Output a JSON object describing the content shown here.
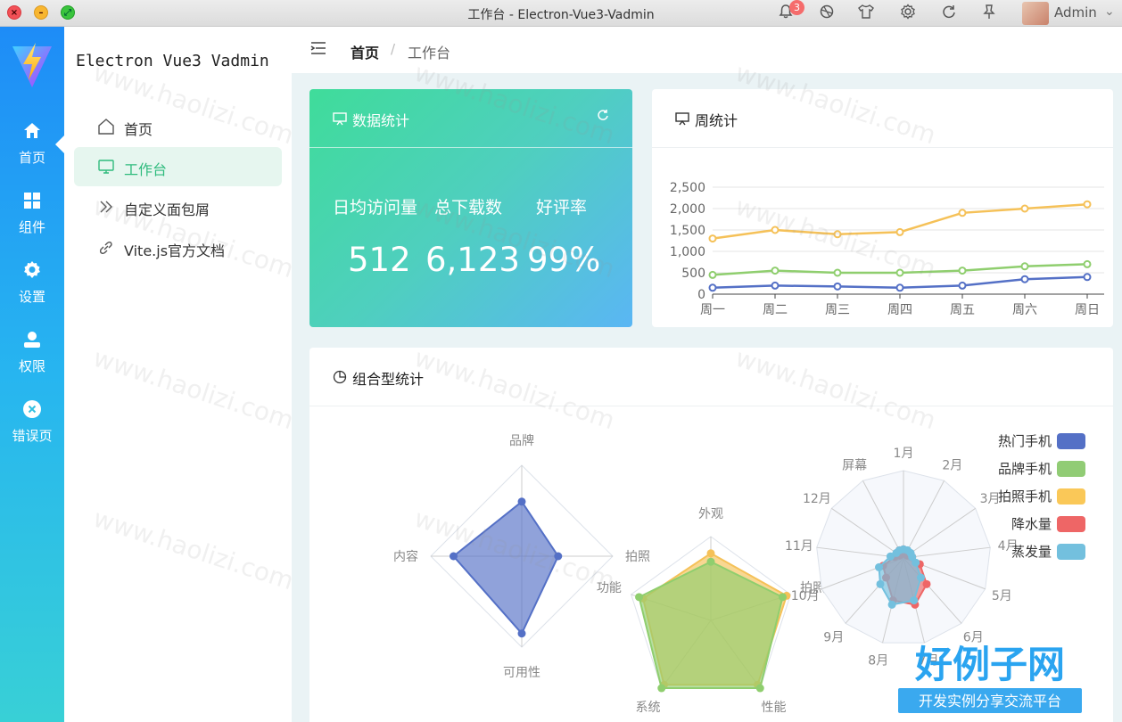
{
  "window": {
    "title": "工作台 - Electron-Vue3-Vadmin",
    "notification_count": "3",
    "user_name": "Admin"
  },
  "rail": {
    "items": [
      {
        "label": "首页",
        "icon": "home-icon"
      },
      {
        "label": "组件",
        "icon": "grid-icon"
      },
      {
        "label": "设置",
        "icon": "gear-icon"
      },
      {
        "label": "权限",
        "icon": "user-icon"
      },
      {
        "label": "错误页",
        "icon": "close-circle-icon"
      }
    ],
    "active": "首页"
  },
  "sidebar": {
    "app_name": "Electron Vue3 Vadmin",
    "items": [
      {
        "label": "首页",
        "icon": "home-outline-icon"
      },
      {
        "label": "工作台",
        "icon": "monitor-icon"
      },
      {
        "label": "自定义面包屑",
        "icon": "double-chevron-icon"
      },
      {
        "label": "Vite.js官方文档",
        "icon": "link-icon"
      }
    ],
    "active": "工作台"
  },
  "breadcrumb": {
    "home": "首页",
    "separator": "/",
    "current": "工作台"
  },
  "stats_card": {
    "title": "数据统计",
    "labels": [
      "日均访问量",
      "总下载数",
      "好评率"
    ],
    "values": [
      "512",
      "6,123",
      "99%"
    ],
    "colors": {
      "from": "#3fdc9a",
      "to": "#5ab6f4"
    }
  },
  "week_card": {
    "title": "周统计"
  },
  "combo_card": {
    "title": "组合型统计"
  },
  "watermark": "www.haolizi.com",
  "brand": {
    "name": "好例子网",
    "tagline": "开发实例分享交流平台"
  },
  "chart_data": [
    {
      "type": "line",
      "x": [
        "周一",
        "周二",
        "周三",
        "周四",
        "周五",
        "周六",
        "周日"
      ],
      "ylim": [
        0,
        2500
      ],
      "yticks": [
        "0",
        "500",
        "1,000",
        "1,500",
        "2,000",
        "2,500"
      ],
      "series": [
        {
          "values": [
            1300,
            1500,
            1400,
            1450,
            1900,
            2000,
            2100
          ],
          "color": "#f5c158"
        },
        {
          "values": [
            450,
            550,
            500,
            500,
            550,
            650,
            700
          ],
          "color": "#8fce6e"
        },
        {
          "values": [
            150,
            200,
            180,
            150,
            200,
            350,
            400
          ],
          "color": "#5470c6"
        }
      ],
      "grid": true
    },
    {
      "type": "radar",
      "indicators": [
        "品牌",
        "拍照",
        "可用性",
        "内容"
      ],
      "series": [
        {
          "values": [
            0.6,
            0.4,
            0.85,
            0.75
          ],
          "color": "#5470c6"
        }
      ]
    },
    {
      "type": "radar",
      "indicators": [
        "外观",
        "拍照",
        "性能",
        "系统",
        "功能"
      ],
      "series": [
        {
          "values": [
            0.8,
            0.95,
            0.95,
            0.95,
            0.85
          ],
          "color": "#f5c158"
        },
        {
          "values": [
            0.7,
            0.9,
            1.0,
            1.0,
            0.9
          ],
          "color": "#8fce6e"
        }
      ]
    },
    {
      "type": "radar",
      "indicators": [
        "1月",
        "2月",
        "3月",
        "4月",
        "5月",
        "6月",
        "7月",
        "8月",
        "9月",
        "10月",
        "11月",
        "12月",
        "屏幕"
      ],
      "series": [
        {
          "name": "降水量",
          "values": [
            0.1,
            0.05,
            0.05,
            0.1,
            0.2,
            0.4,
            0.55,
            0.5,
            0.3,
            0.25,
            0.1,
            0.05,
            0.1
          ],
          "color": "#ee6666"
        },
        {
          "name": "蒸发量",
          "values": [
            0.1,
            0.1,
            0.1,
            0.1,
            0.15,
            0.3,
            0.5,
            0.55,
            0.4,
            0.3,
            0.15,
            0.1,
            0.1
          ],
          "color": "#73c0de"
        }
      ],
      "legend": [
        "热门手机",
        "品牌手机",
        "拍照手机",
        "降水量",
        "蒸发量"
      ],
      "legend_colors": [
        "#5470c6",
        "#91cc75",
        "#fac858",
        "#ee6666",
        "#73c0de"
      ],
      "legend_position": "top-right"
    }
  ]
}
